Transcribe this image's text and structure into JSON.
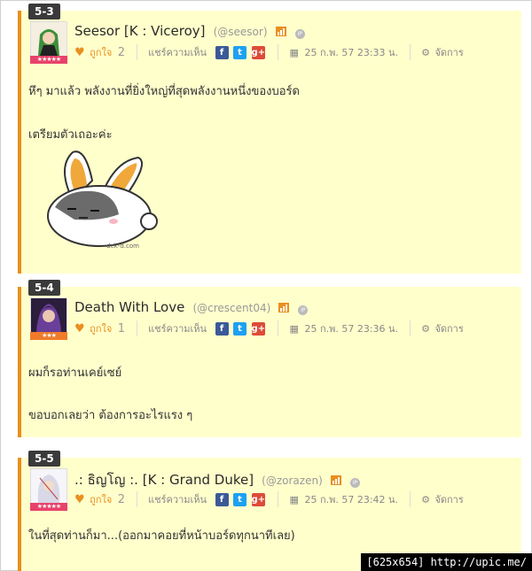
{
  "posts": [
    {
      "number": "5-3",
      "author": "Seesor [K : Viceroy]",
      "handle": "(@seesor)",
      "like_label": "ถูกใจ",
      "like_count": "2",
      "share_label": "แชร์ความเห็น",
      "date": "25 ก.พ. 57 23:33 น.",
      "manage_label": "จัดการ",
      "stars": "★★★★★",
      "star_color": "#e8426a",
      "lines": [
        "หึๆ มาแล้ว พลังงานที่ยิ่งใหญ่ที่สุดพลังงานหนึ่งของบอร์ด",
        "เตรียมตัวเถอะค่ะ"
      ],
      "sticker_text": "dek-d.com"
    },
    {
      "number": "5-4",
      "author": "Death With Love",
      "handle": "(@crescent04)",
      "like_label": "ถูกใจ",
      "like_count": "1",
      "share_label": "แชร์ความเห็น",
      "date": "25 ก.พ. 57 23:36 น.",
      "manage_label": "จัดการ",
      "stars": "★★★",
      "star_color": "#f07b2a",
      "lines": [
        "ผมก็รอท่านเคย์เซย์",
        "ขอบอกเลยว่า ต้องการอะไรแรง ๆ"
      ]
    },
    {
      "number": "5-5",
      "author": ".: ธิญโญ :. [K : Grand Duke]",
      "handle": "(@zorazen)",
      "like_label": "ถูกใจ",
      "like_count": "2",
      "share_label": "แชร์ความเห็น",
      "date": "25 ก.พ. 57 23:42 น.",
      "manage_label": "จัดการ",
      "stars": "★★★★★",
      "star_color": "#e8426a",
      "lines": [
        "ในที่สุดท่านก็มา...(ออกมาคอยที่หน้าบอร์ดทุกนาทีเลย)"
      ]
    }
  ],
  "icons": {
    "heart": "heart-icon",
    "facebook": "f",
    "twitter": "t",
    "googleplus": "g+",
    "calendar": "calendar-icon",
    "gear": "gear-icon"
  },
  "watermark": "[625x654] http://upic.me/"
}
